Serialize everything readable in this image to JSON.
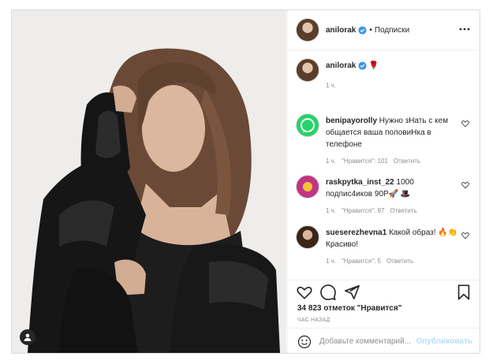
{
  "post": {
    "photo_alt": "",
    "header": {
      "username": "anilorak",
      "separator": "•",
      "follow_label": "Подписки"
    },
    "caption": {
      "username": "anilorak",
      "emoji": "🌹",
      "time": "1 ч."
    },
    "comments": [
      {
        "username": "benipayorolly",
        "text": "Нужно зНать с кем общается ваша половиНка в телефоне",
        "time": "1 ч.",
        "likes": "\"Нравится\": 101",
        "reply": "Ответить"
      },
      {
        "username": "raskpytka_inst_22",
        "text": "1000 подпис4иков 90Р🚀 🎩",
        "time": "1 ч.",
        "likes": "\"Нравится\": 97",
        "reply": "Ответить"
      },
      {
        "username": "sueserezhevna1",
        "text": "Какой образ! 🔥👏 Красиво!",
        "time": "1 ч.",
        "likes": "\"Нравится\": 5",
        "reply": "Ответить"
      }
    ],
    "likes_count": "34 823 отметок \"Нравится\"",
    "time_ago": "ЧАС НАЗАД",
    "add_comment_placeholder": "Добавьте комментарий...",
    "publish_label": "Опубликовать"
  },
  "colors": {
    "border": "#dbdbdb",
    "muted": "#8e8e8e",
    "verified": "#3897f0",
    "publish_disabled": "#b2dffc"
  },
  "icons": [
    "more-icon",
    "verified-icon",
    "heart-icon",
    "comment-icon",
    "share-icon",
    "bookmark-icon",
    "smile-icon",
    "user-tag-icon"
  ]
}
